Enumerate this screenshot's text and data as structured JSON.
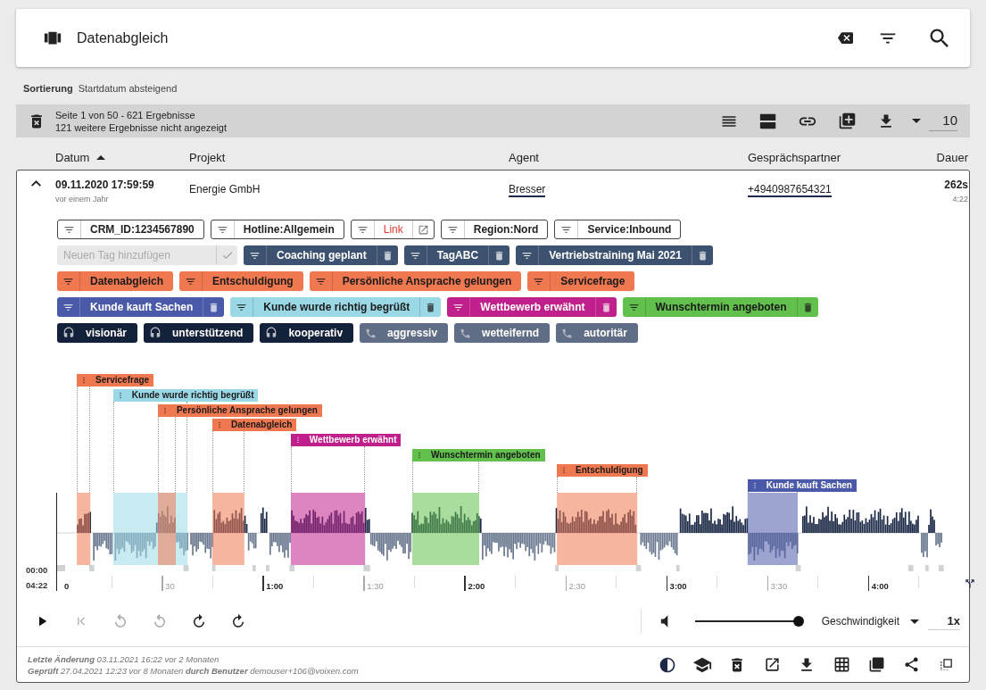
{
  "header": {
    "title": "Datenabgleich"
  },
  "sorting": {
    "label": "Sortierung",
    "value": "Startdatum absteigend"
  },
  "results": {
    "line_1": "Seite 1 von 50 - 621 Ergebnisse",
    "line_2": "121 weitere Ergebnisse nicht angezeigt",
    "page_size": "10"
  },
  "columns": [
    {
      "label": "Datum",
      "sorted": true
    },
    {
      "label": "Projekt",
      "sorted": false
    },
    {
      "label": "Agent",
      "sorted": false
    },
    {
      "label": "Gesprächspartner",
      "sorted": false
    },
    {
      "label": "Dauer",
      "sorted": false
    }
  ],
  "record": {
    "expanded": true,
    "date": "09.11.2020 17:59:59",
    "relative": "vor einem Jahr",
    "project": "Energie GmbH",
    "agent": "Bresser",
    "partner": "+4940987654321",
    "duration": "262s",
    "duration_clock": "4:22"
  },
  "info_tags": [
    {
      "kind": "text",
      "label": "CRM_ID:1234567890"
    },
    {
      "kind": "text",
      "label": "Hotline:Allgemein"
    },
    {
      "kind": "link",
      "label": "Link"
    },
    {
      "kind": "text",
      "label": "Region:Nord"
    },
    {
      "kind": "text",
      "label": "Service:Inbound"
    }
  ],
  "new_tag": {
    "placeholder": "Neuen Tag hinzufügen"
  },
  "tag_rows": [
    [
      {
        "label": "Coaching geplant",
        "color": "#3d5270",
        "deletable": true
      },
      {
        "label": "TagABC",
        "color": "#3d5270",
        "deletable": true
      },
      {
        "label": "Vertriebstraining Mai 2021",
        "color": "#3d5270",
        "deletable": true
      }
    ],
    [
      {
        "label": "Datenabgleich",
        "color": "#f07850",
        "deletable": false
      },
      {
        "label": "Entschuldigung",
        "color": "#f07850",
        "deletable": false
      },
      {
        "label": "Persönliche Ansprache gelungen",
        "color": "#f07850",
        "deletable": false
      },
      {
        "label": "Servicefrage",
        "color": "#f07850",
        "deletable": false
      }
    ],
    [
      {
        "label": "Kunde kauft Sachen",
        "color": "#4a5aa8",
        "deletable": true
      },
      {
        "label": "Kunde wurde richtig begrüßt",
        "color": "#9bd8e6",
        "deletable": true
      },
      {
        "label": "Wettbewerb erwähnt",
        "color": "#c0208c",
        "deletable": true
      },
      {
        "label": "Wunschtermin angeboten",
        "color": "#62c04c",
        "deletable": true
      }
    ]
  ],
  "traits": [
    {
      "kind": "agent",
      "label": "visionär",
      "color": "#13213a"
    },
    {
      "kind": "agent",
      "label": "unterstützend",
      "color": "#13213a"
    },
    {
      "kind": "agent",
      "label": "kooperativ",
      "color": "#13213a"
    },
    {
      "kind": "customer",
      "label": "aggressiv",
      "color": "#5f6e86"
    },
    {
      "kind": "customer",
      "label": "wetteifernd",
      "color": "#5f6e86"
    },
    {
      "kind": "customer",
      "label": "autoritär",
      "color": "#5f6e86"
    }
  ],
  "timeline": {
    "start": "00:00",
    "end": "04:22",
    "ticks": [
      "0",
      "30",
      "1:00",
      "1:30",
      "2:00",
      "2:30",
      "3:00",
      "3:30",
      "4:00"
    ],
    "segments": [
      {
        "label": "Servicefrage",
        "color": "#f07850"
      },
      {
        "label": "Kunde wurde richtig begrüßt",
        "color": "#9bd8e6"
      },
      {
        "label": "Persönliche Ansprache gelungen",
        "color": "#f07850"
      },
      {
        "label": "Datenabgleich",
        "color": "#f07850"
      },
      {
        "label": "Wettbewerb erwähnt",
        "color": "#c0208c"
      },
      {
        "label": "Wunschtermin angeboten",
        "color": "#62c04c"
      },
      {
        "label": "Entschuldigung",
        "color": "#f07850"
      },
      {
        "label": "Kunde kauft Sachen",
        "color": "#4a5aa8"
      }
    ]
  },
  "player": {
    "volume": {
      "level": 1
    },
    "speed_label": "Geschwindigkeit",
    "speed": "1x"
  },
  "footer": {
    "line_1": "**Letzte Änderung** 03.11.2021 16:22 vor 2 Monaten",
    "line_2": "**Geprüft** 27.04.2021 12:23 vor 8 Monaten **durch Benutzer** demouser+106@voixen.com"
  }
}
